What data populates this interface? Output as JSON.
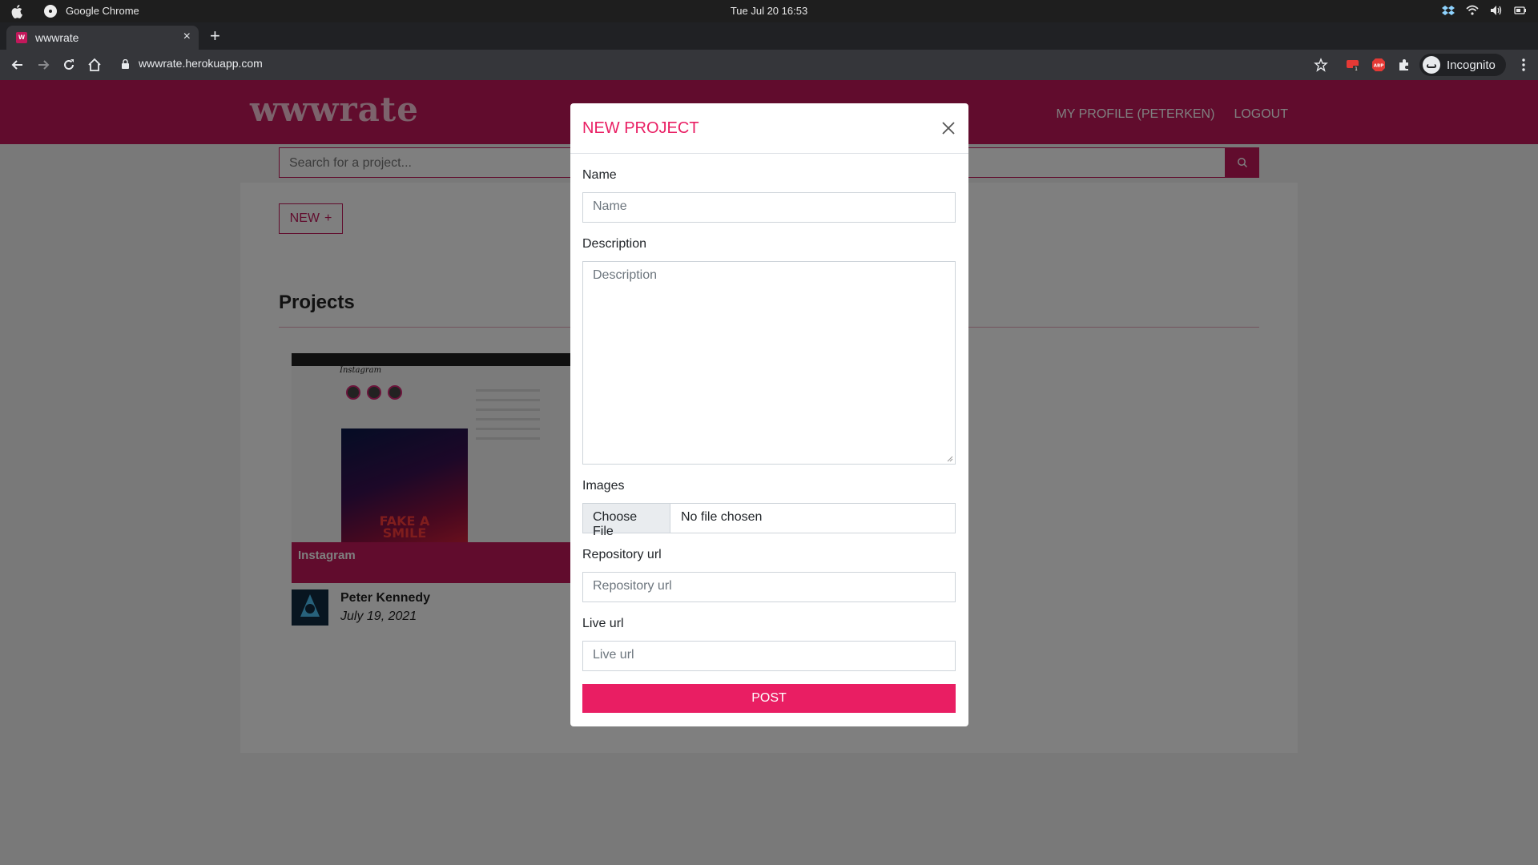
{
  "os": {
    "app_name": "Google Chrome",
    "clock": "Tue Jul 20  16:53",
    "icons": [
      "apple-icon",
      "chrome-icon",
      "dropbox-icon",
      "wifi-icon",
      "volume-icon",
      "battery-icon"
    ]
  },
  "browser": {
    "tab_title": "wwwrate",
    "tab_favicon": "w",
    "tab_close": "×",
    "new_tab": "+",
    "url": "wwwrate.herokuapp.com",
    "incognito_label": "Incognito",
    "window_colors": {
      "minimize": "#f5b400",
      "maximize": "#2ecc40",
      "close": "#ff3b30"
    }
  },
  "site": {
    "logo": "wwwrate",
    "nav": {
      "profile": "MY PROFILE (PETERKEN)",
      "logout": "LOGOUT"
    },
    "search_placeholder": "Search for a project...",
    "new_button": "NEW",
    "new_button_icon": "+",
    "projects_title": "Projects",
    "project": {
      "title": "Instagram",
      "thumbnail_logo": "Instagram",
      "poster_text": "FAKE A SMILE",
      "author": "Peter Kennedy",
      "date": "July 19, 2021"
    },
    "colors": {
      "brand": "#c2185b",
      "accent": "#e91e63"
    }
  },
  "modal": {
    "title": "NEW PROJECT",
    "name_label": "Name",
    "name_placeholder": "Name",
    "description_label": "Description",
    "description_placeholder": "Description",
    "images_label": "Images",
    "choose_file": "Choose File",
    "no_file": "No file chosen",
    "repo_label": "Repository url",
    "repo_placeholder": "Repository url",
    "live_label": "Live url",
    "live_placeholder": "Live url",
    "post_button": "POST"
  }
}
